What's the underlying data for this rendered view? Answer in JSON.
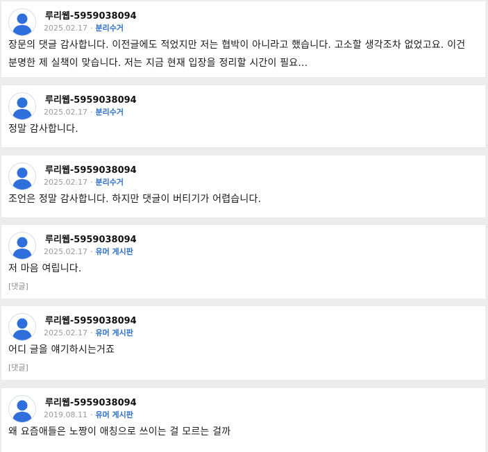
{
  "icons": {
    "avatar": "user-avatar-icon"
  },
  "colors": {
    "avatar_blue": "#2f6fdc",
    "board_link": "#2e6fc9",
    "background": "#ececec",
    "card": "#ffffff"
  },
  "posts": [
    {
      "username": "루리웹-5959038094",
      "date": "2025.02.17",
      "separator": "·",
      "board": "분리수거",
      "body": "장문의 댓글 감사합니다. 이전글에도 적었지만 저는 협박이 아니라고 했습니다. 고소할 생각조차 없었고요. 이건 분명한 제 실책이 맞습니다. 저는 지금 현재 입장을 정리할 시간이 필요...",
      "tag": ""
    },
    {
      "username": "루리웹-5959038094",
      "date": "2025.02.17",
      "separator": "·",
      "board": "분리수거",
      "body": "정말 감사합니다.",
      "tag": ""
    },
    {
      "username": "루리웹-5959038094",
      "date": "2025.02.17",
      "separator": "·",
      "board": "분리수거",
      "body": "조언은 정말 감사합니다. 하지만 댓글이 버티기가 어렵습니다.",
      "tag": ""
    },
    {
      "username": "루리웹-5959038094",
      "date": "2025.02.17",
      "separator": "·",
      "board": "유머 게시판",
      "body": "저 마음 여립니다.",
      "tag": "[댓글]"
    },
    {
      "username": "루리웹-5959038094",
      "date": "2025.02.17",
      "separator": "·",
      "board": "유머 게시판",
      "body": "어디 글을 얘기하시는거죠",
      "tag": "[댓글]"
    },
    {
      "username": "루리웹-5959038094",
      "date": "2019.08.11",
      "separator": "·",
      "board": "유머 게시판",
      "body": "왜 요즘애들은 노짱이 애칭으로 쓰이는 걸 모르는 걸까",
      "tag": ""
    }
  ]
}
